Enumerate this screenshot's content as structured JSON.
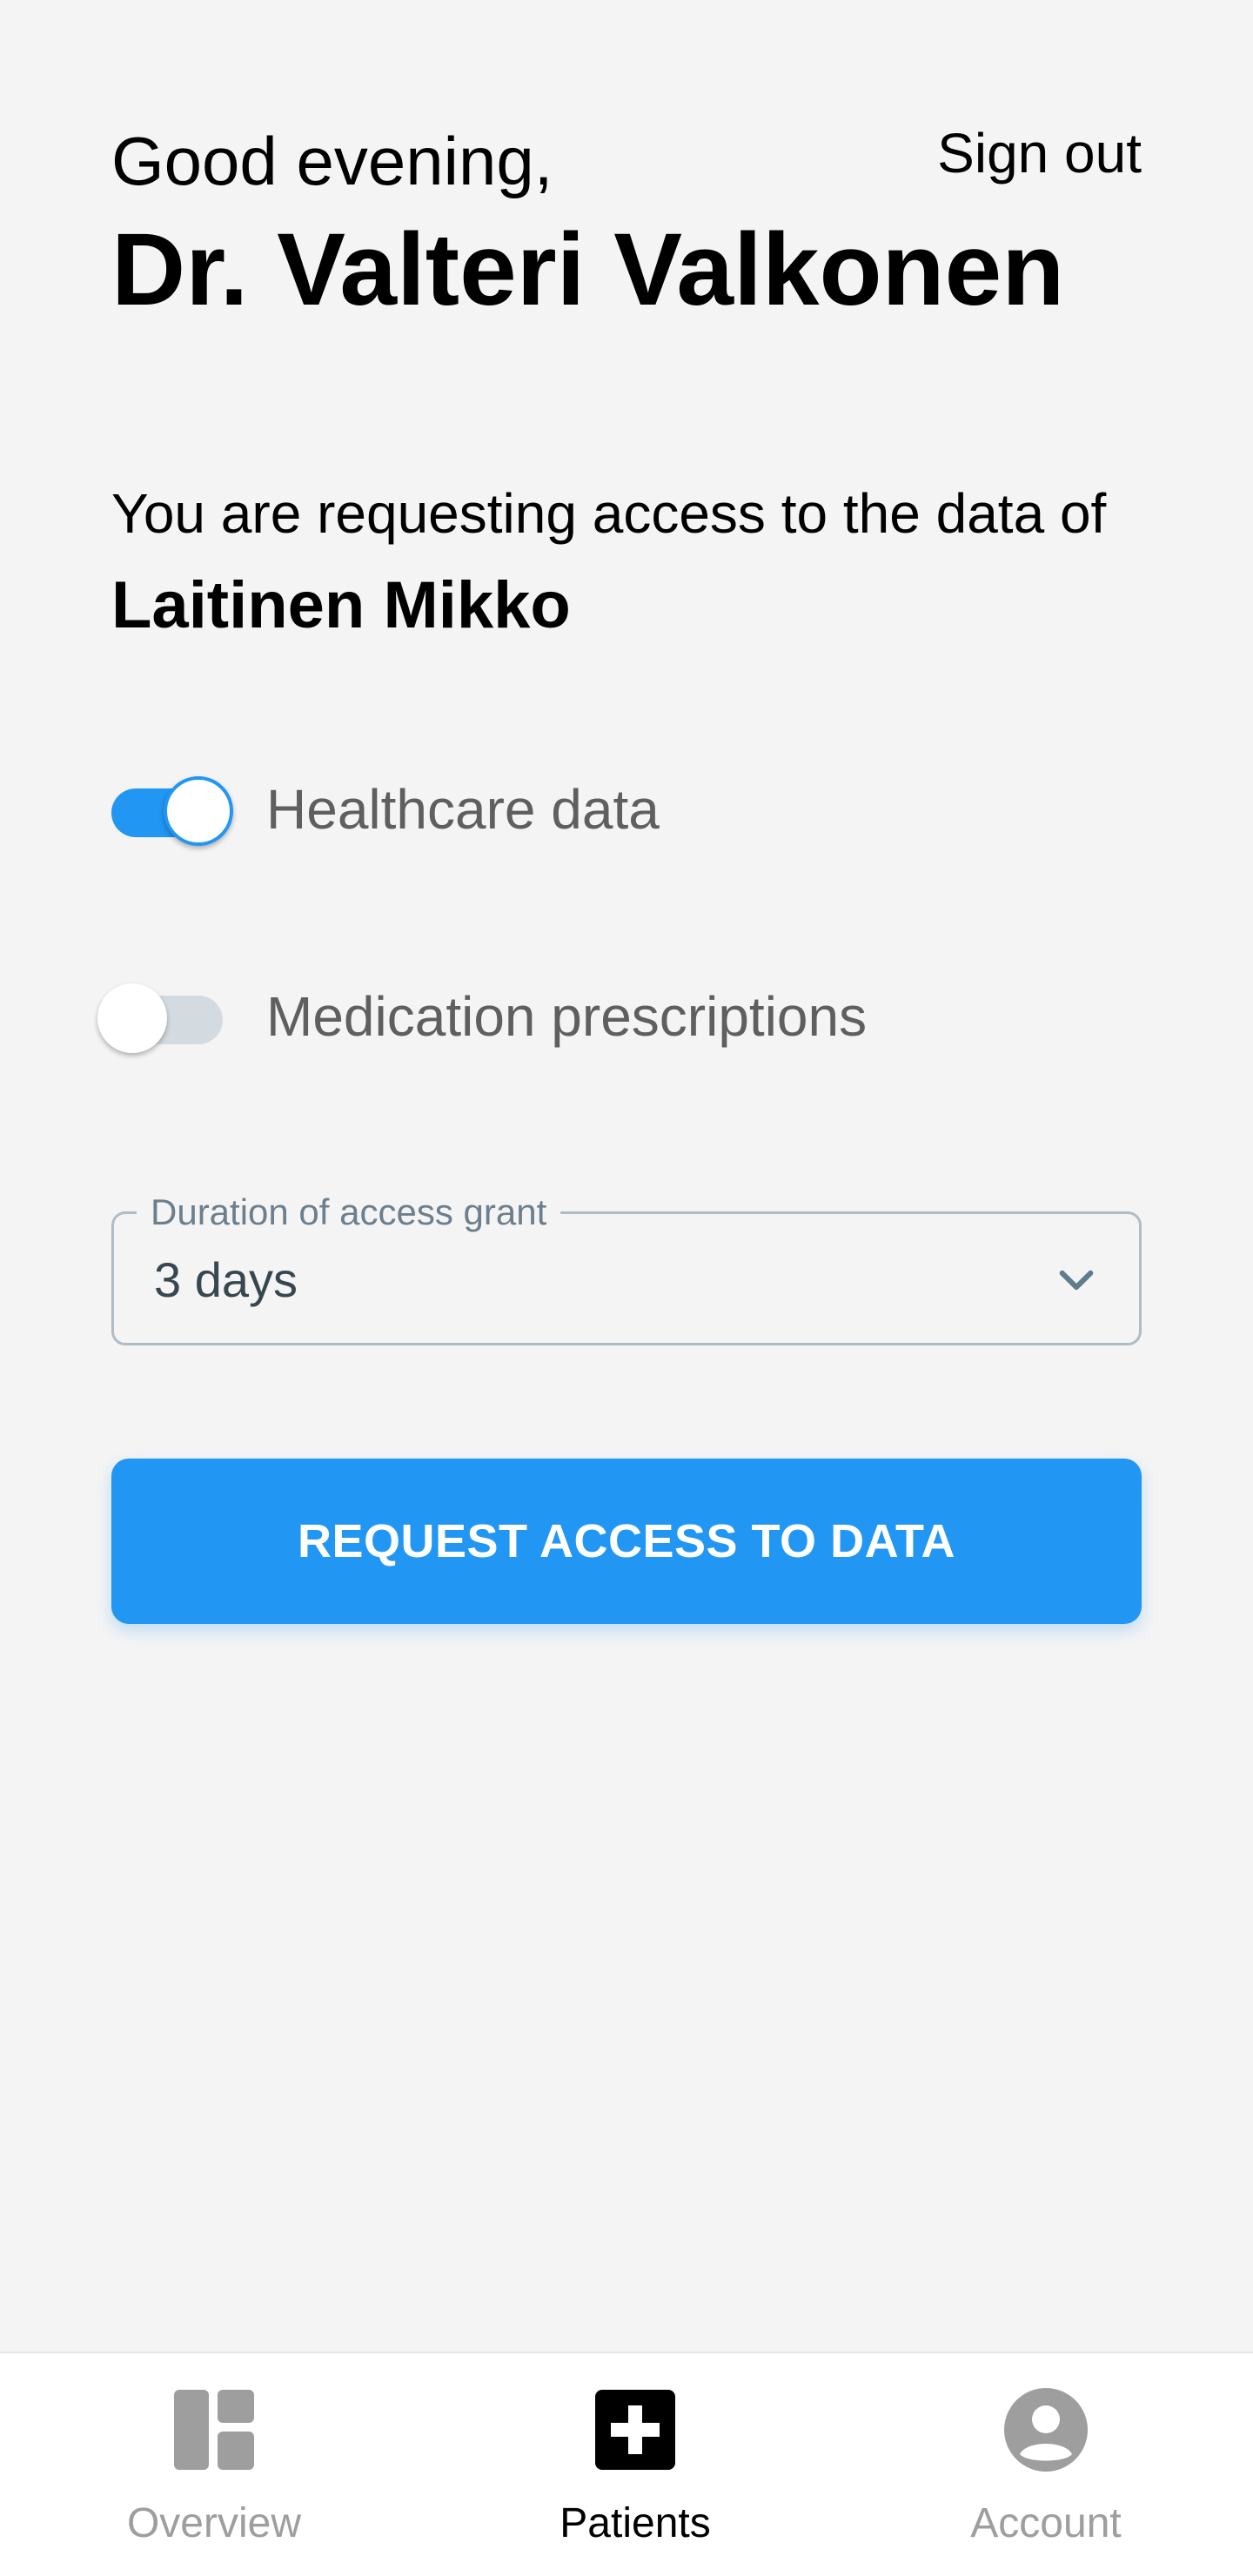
{
  "header": {
    "greeting": "Good evening,",
    "doctor_name": "Dr. Valteri Valkonen",
    "sign_out_label": "Sign out"
  },
  "request": {
    "intro_text": "You are requesting access to the data of",
    "patient_name": "Laitinen Mikko"
  },
  "toggles": [
    {
      "label": "Healthcare data",
      "enabled": true
    },
    {
      "label": "Medication prescriptions",
      "enabled": false
    }
  ],
  "duration_select": {
    "label": "Duration of access grant",
    "value": "3 days"
  },
  "primary_action": {
    "label": "REQUEST ACCESS TO DATA"
  },
  "bottom_nav": {
    "items": [
      {
        "label": "Overview",
        "icon": "dashboard-icon",
        "active": false
      },
      {
        "label": "Patients",
        "icon": "medical-cross-icon",
        "active": true
      },
      {
        "label": "Account",
        "icon": "account-circle-icon",
        "active": false
      }
    ]
  },
  "colors": {
    "background": "#f4f4f5",
    "accent": "#2196f3",
    "switch_off_track": "#d3dbe0",
    "nav_inactive": "#9e9e9e",
    "nav_active": "#000000"
  }
}
